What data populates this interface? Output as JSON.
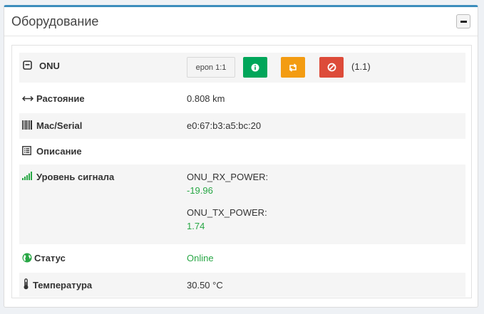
{
  "panel": {
    "title": "Оборудование"
  },
  "onu": {
    "label": "ONU",
    "epon_button": "epon 1:1",
    "port_info": "(1.1)"
  },
  "rows": {
    "distance": {
      "label": "Растояние",
      "value": "0.808 km"
    },
    "mac": {
      "label": "Mac/Serial",
      "value": "e0:67:b3:a5:bc:20"
    },
    "description": {
      "label": "Описание",
      "value": ""
    },
    "signal": {
      "label": "Уровень сигнала",
      "rx_label": "ONU_RX_POWER:",
      "rx_value": "-19.96",
      "tx_label": "ONU_TX_POWER:",
      "tx_value": "1.74"
    },
    "status": {
      "label": "Статус",
      "value": "Online"
    },
    "temperature": {
      "label": "Температура",
      "value": "30.50 °C"
    }
  },
  "colors": {
    "accent": "#3c8dbc",
    "success": "#00a65a",
    "warning": "#f39c12",
    "danger": "#dd4b39",
    "value_green": "#28a745"
  }
}
